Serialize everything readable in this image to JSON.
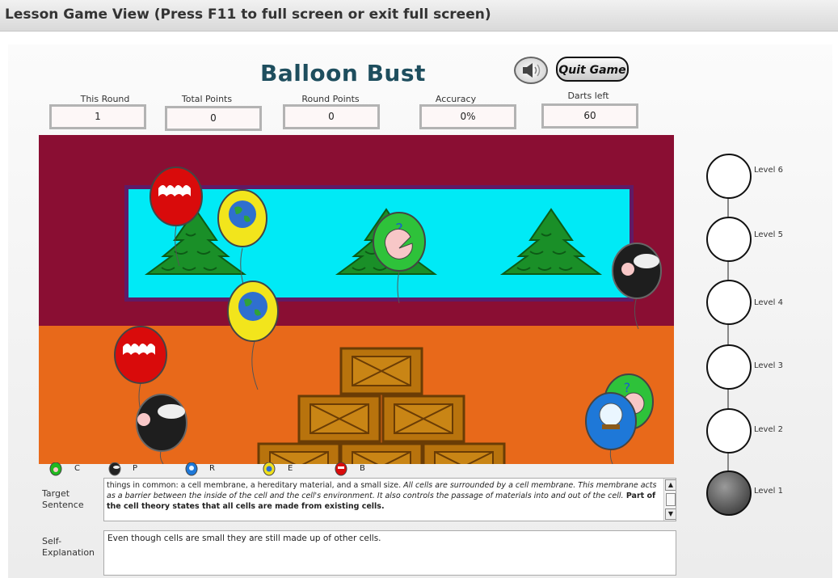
{
  "header": {
    "title": "Lesson Game View (Press F11 to full screen or exit full screen)"
  },
  "game": {
    "title": "Balloon Bust",
    "quit_label": "Quit Game"
  },
  "stats": [
    {
      "label": "This Round",
      "value": "1"
    },
    {
      "label": "Total Points",
      "value": "0"
    },
    {
      "label": "Round Points",
      "value": "0"
    },
    {
      "label": "Accuracy",
      "value": "0%"
    },
    {
      "label": "Darts left",
      "value": "60"
    }
  ],
  "legend": [
    {
      "letter": "C",
      "color": "#1fb81f",
      "icon": "pacman-balloon-icon"
    },
    {
      "letter": "P",
      "color": "#222222",
      "icon": "speech-balloon-icon"
    },
    {
      "letter": "R",
      "color": "#1e78d8",
      "icon": "crystal-ball-balloon-icon"
    },
    {
      "letter": "E",
      "color": "#f0e01c",
      "icon": "earth-balloon-icon"
    },
    {
      "letter": "B",
      "color": "#d90b0b",
      "icon": "brain-balloon-icon"
    }
  ],
  "target": {
    "label_line1": "Target",
    "label_line2": "Sentence",
    "text_normal1": "things in common: a cell membrane, a hereditary material, and a small size. ",
    "text_italic": "All cells are surrounded by a cell membrane. This membrane acts as a barrier between the inside of the cell and the cell's environment. It also controls the passage of materials into and out of the cell.",
    "text_bold": " Part of the cell theory states that all cells are made from existing cells."
  },
  "self_explanation": {
    "label_line1": "Self-",
    "label_line2": "Explanation",
    "text": "Even though cells are small they are still made up of other cells."
  },
  "levels": [
    {
      "label": "Level 6",
      "completed": false
    },
    {
      "label": "Level 5",
      "completed": false
    },
    {
      "label": "Level 4",
      "completed": false
    },
    {
      "label": "Level 3",
      "completed": false
    },
    {
      "label": "Level 2",
      "completed": false
    },
    {
      "label": "Level 1",
      "completed": true
    }
  ],
  "colors": {
    "wall": "#8a0e33",
    "floor": "#e8691a",
    "window": "#00eaf6",
    "title": "#1e4e5e"
  }
}
